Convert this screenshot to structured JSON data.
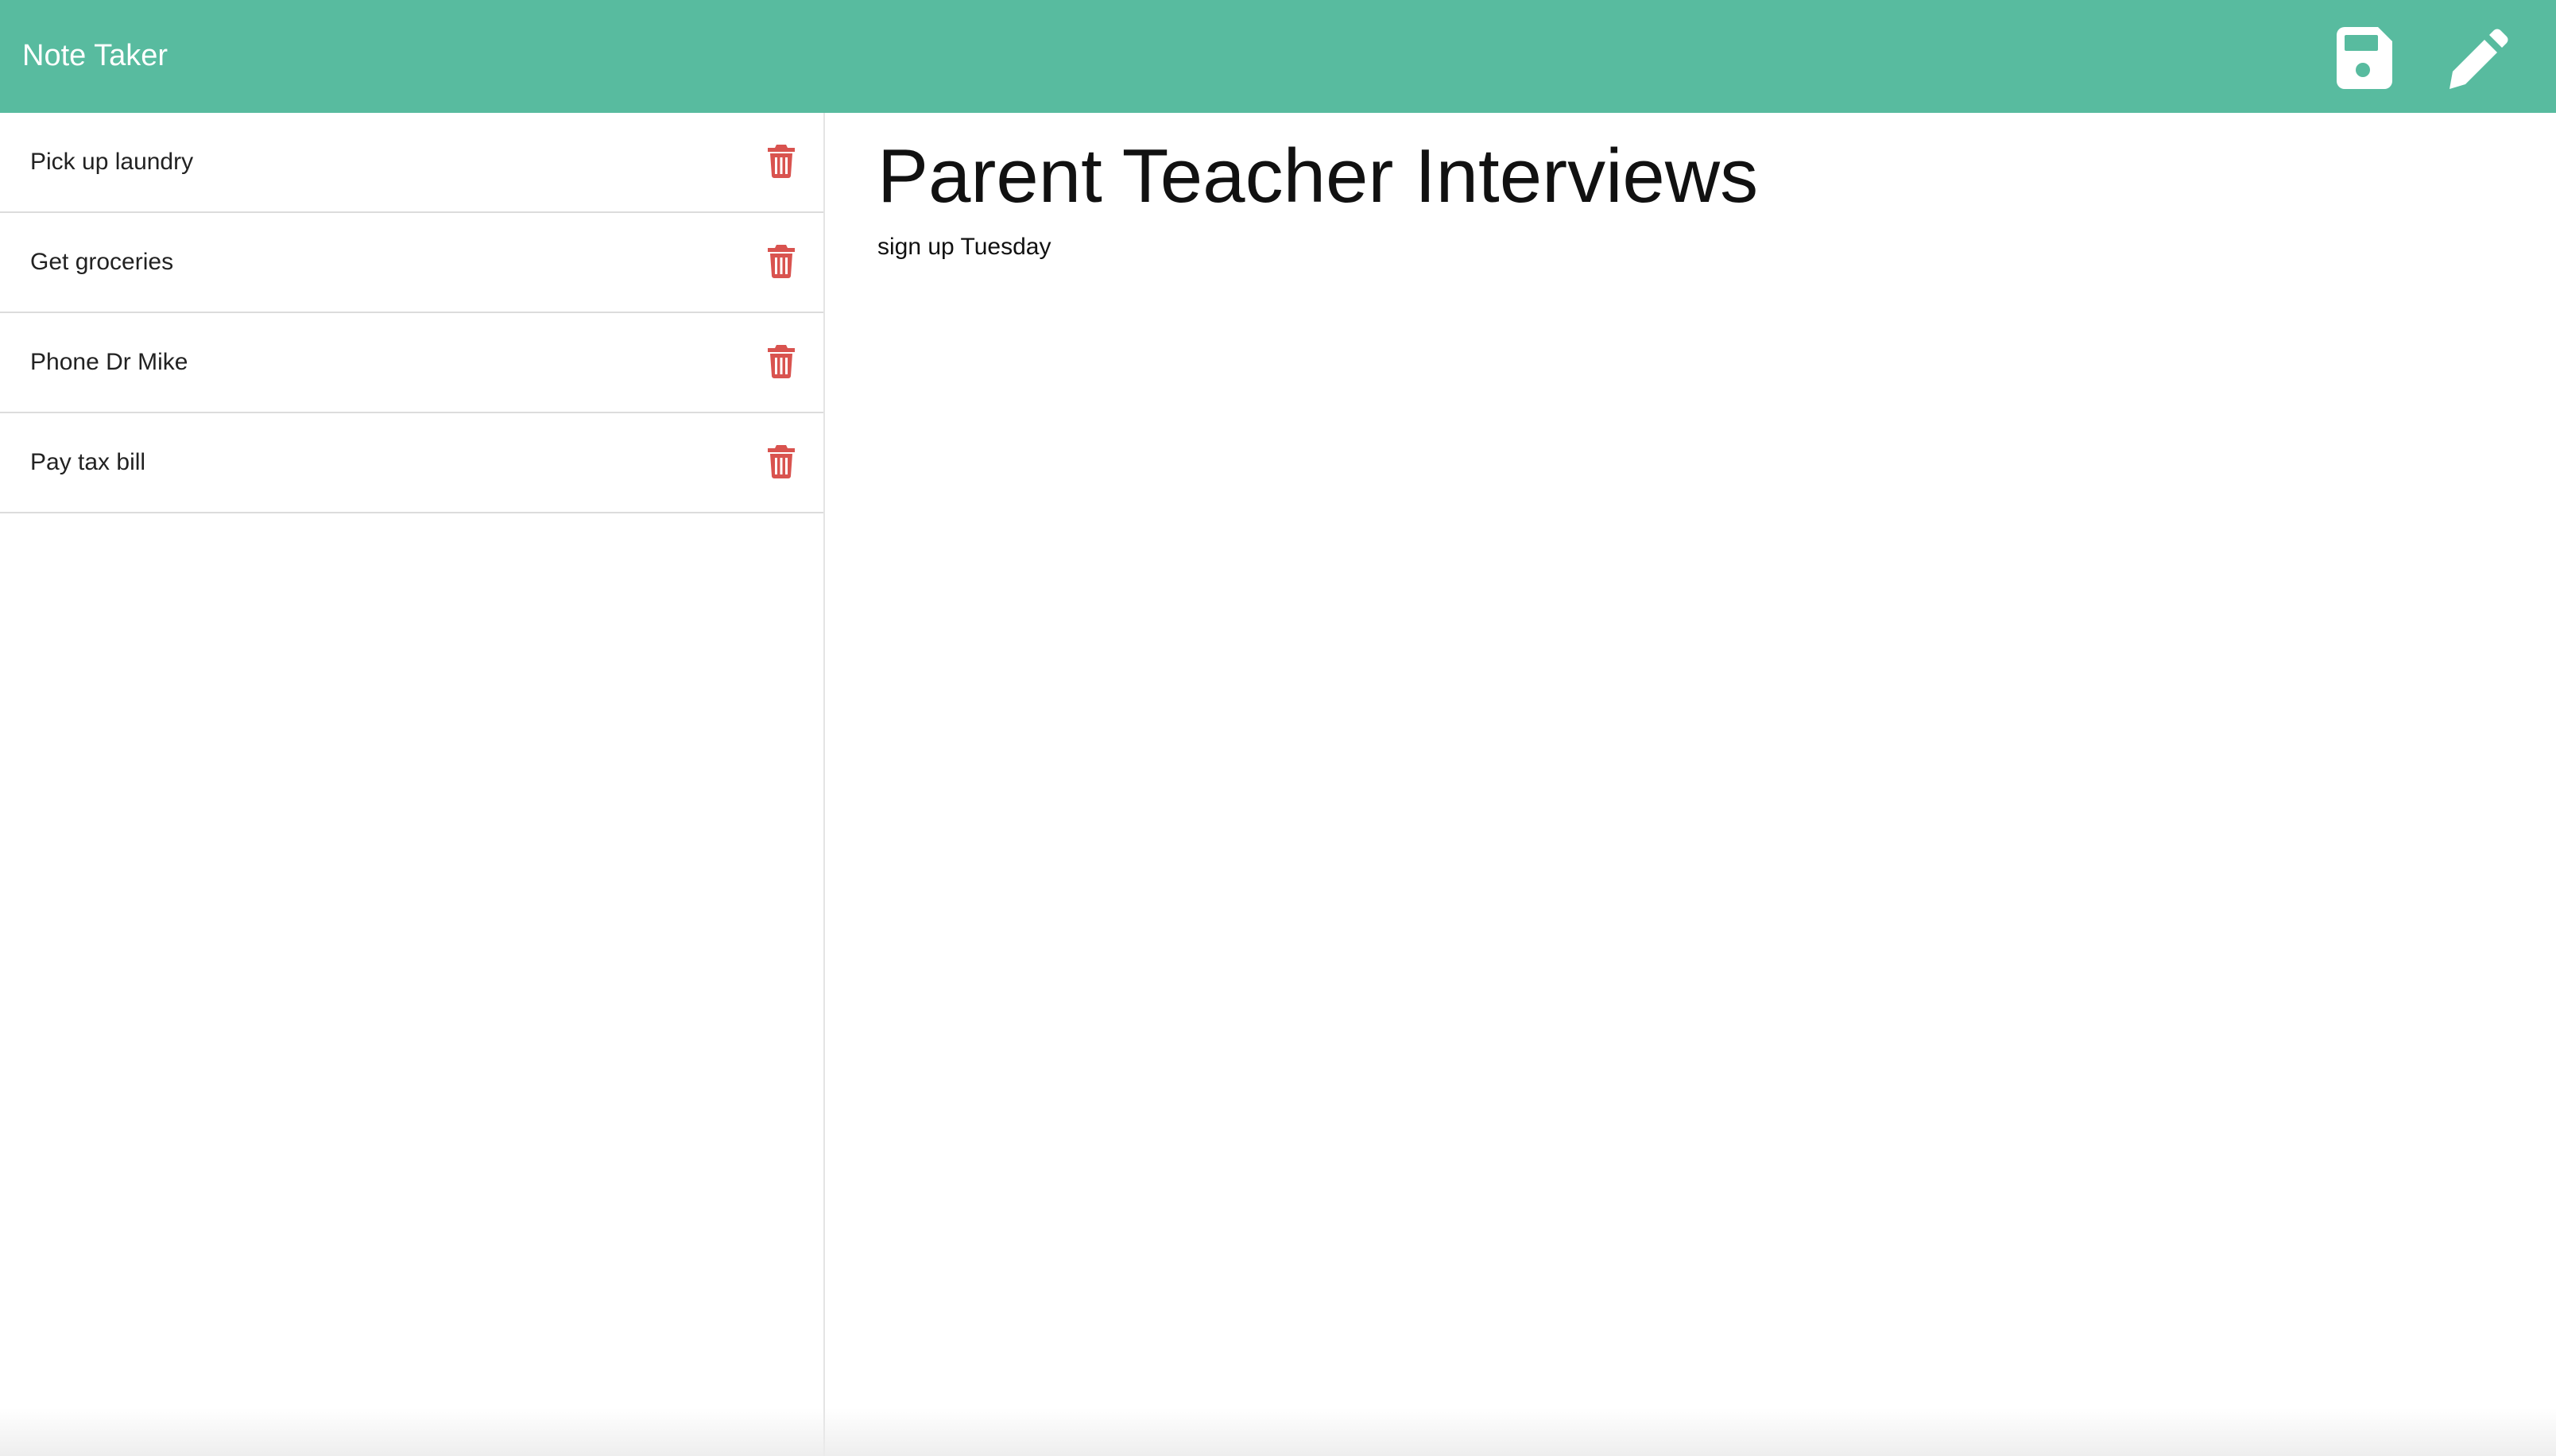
{
  "app": {
    "title": "Note Taker"
  },
  "toolbar": {
    "save_icon": "save-icon",
    "new_note_icon": "pencil-icon",
    "icon_color": "#ffffff",
    "bar_color": "#58bb9f"
  },
  "sidebar": {
    "items": [
      {
        "label": "Pick up laundry"
      },
      {
        "label": "Get groceries"
      },
      {
        "label": "Phone Dr Mike"
      },
      {
        "label": "Pay tax bill"
      }
    ],
    "delete_icon": "trash-icon",
    "delete_color": "#d9534f"
  },
  "editor": {
    "title": "Parent Teacher Interviews",
    "text": "sign up Tuesday"
  }
}
